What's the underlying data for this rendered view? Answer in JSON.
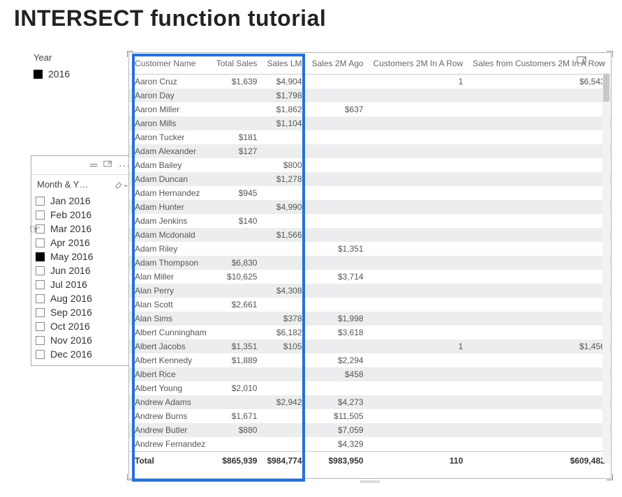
{
  "title": "INTERSECT function tutorial",
  "yearSlicer": {
    "label": "Year",
    "items": [
      {
        "label": "2016",
        "checked": true
      }
    ]
  },
  "monthSlicer": {
    "title": "Month & Y…",
    "items": [
      {
        "label": "Jan 2016",
        "checked": false
      },
      {
        "label": "Feb 2016",
        "checked": false
      },
      {
        "label": "Mar 2016",
        "checked": false
      },
      {
        "label": "Apr 2016",
        "checked": false
      },
      {
        "label": "May 2016",
        "checked": true
      },
      {
        "label": "Jun 2016",
        "checked": false
      },
      {
        "label": "Jul 2016",
        "checked": false
      },
      {
        "label": "Aug 2016",
        "checked": false
      },
      {
        "label": "Sep 2016",
        "checked": false
      },
      {
        "label": "Oct 2016",
        "checked": false
      },
      {
        "label": "Nov 2016",
        "checked": false
      },
      {
        "label": "Dec 2016",
        "checked": false
      }
    ]
  },
  "table": {
    "columns": [
      "Customer Name",
      "Total Sales",
      "Sales LM",
      "Sales 2M Ago",
      "Customers 2M In A Row",
      "Sales from Customers 2M In A Row"
    ],
    "rows": [
      {
        "name": "Aaron Cruz",
        "totalSales": "$1,639",
        "salesLM": "$4,904",
        "sales2M": "",
        "c2m": "1",
        "sf2m": "$6,543"
      },
      {
        "name": "Aaron Day",
        "totalSales": "",
        "salesLM": "$1,798",
        "sales2M": "",
        "c2m": "",
        "sf2m": ""
      },
      {
        "name": "Aaron Miller",
        "totalSales": "",
        "salesLM": "$1,862",
        "sales2M": "$637",
        "c2m": "",
        "sf2m": ""
      },
      {
        "name": "Aaron Mills",
        "totalSales": "",
        "salesLM": "$1,104",
        "sales2M": "",
        "c2m": "",
        "sf2m": ""
      },
      {
        "name": "Aaron Tucker",
        "totalSales": "$181",
        "salesLM": "",
        "sales2M": "",
        "c2m": "",
        "sf2m": ""
      },
      {
        "name": "Adam Alexander",
        "totalSales": "$127",
        "salesLM": "",
        "sales2M": "",
        "c2m": "",
        "sf2m": ""
      },
      {
        "name": "Adam Bailey",
        "totalSales": "",
        "salesLM": "$800",
        "sales2M": "",
        "c2m": "",
        "sf2m": ""
      },
      {
        "name": "Adam Duncan",
        "totalSales": "",
        "salesLM": "$1,278",
        "sales2M": "",
        "c2m": "",
        "sf2m": ""
      },
      {
        "name": "Adam Hernandez",
        "totalSales": "$945",
        "salesLM": "",
        "sales2M": "",
        "c2m": "",
        "sf2m": ""
      },
      {
        "name": "Adam Hunter",
        "totalSales": "",
        "salesLM": "$4,990",
        "sales2M": "",
        "c2m": "",
        "sf2m": ""
      },
      {
        "name": "Adam Jenkins",
        "totalSales": "$140",
        "salesLM": "",
        "sales2M": "",
        "c2m": "",
        "sf2m": ""
      },
      {
        "name": "Adam Mcdonald",
        "totalSales": "",
        "salesLM": "$1,566",
        "sales2M": "",
        "c2m": "",
        "sf2m": ""
      },
      {
        "name": "Adam Riley",
        "totalSales": "",
        "salesLM": "",
        "sales2M": "$1,351",
        "c2m": "",
        "sf2m": ""
      },
      {
        "name": "Adam Thompson",
        "totalSales": "$6,830",
        "salesLM": "",
        "sales2M": "",
        "c2m": "",
        "sf2m": ""
      },
      {
        "name": "Alan Miller",
        "totalSales": "$10,625",
        "salesLM": "",
        "sales2M": "$3,714",
        "c2m": "",
        "sf2m": ""
      },
      {
        "name": "Alan Perry",
        "totalSales": "",
        "salesLM": "$4,308",
        "sales2M": "",
        "c2m": "",
        "sf2m": ""
      },
      {
        "name": "Alan Scott",
        "totalSales": "$2,661",
        "salesLM": "",
        "sales2M": "",
        "c2m": "",
        "sf2m": ""
      },
      {
        "name": "Alan Sims",
        "totalSales": "",
        "salesLM": "$378",
        "sales2M": "$1,998",
        "c2m": "",
        "sf2m": ""
      },
      {
        "name": "Albert Cunningham",
        "totalSales": "",
        "salesLM": "$6,182",
        "sales2M": "$3,618",
        "c2m": "",
        "sf2m": ""
      },
      {
        "name": "Albert Jacobs",
        "totalSales": "$1,351",
        "salesLM": "$105",
        "sales2M": "",
        "c2m": "1",
        "sf2m": "$1,456"
      },
      {
        "name": "Albert Kennedy",
        "totalSales": "$1,889",
        "salesLM": "",
        "sales2M": "$2,294",
        "c2m": "",
        "sf2m": ""
      },
      {
        "name": "Albert Rice",
        "totalSales": "",
        "salesLM": "",
        "sales2M": "$458",
        "c2m": "",
        "sf2m": ""
      },
      {
        "name": "Albert Young",
        "totalSales": "$2,010",
        "salesLM": "",
        "sales2M": "",
        "c2m": "",
        "sf2m": ""
      },
      {
        "name": "Andrew Adams",
        "totalSales": "",
        "salesLM": "$2,942",
        "sales2M": "$4,273",
        "c2m": "",
        "sf2m": ""
      },
      {
        "name": "Andrew Burns",
        "totalSales": "$1,671",
        "salesLM": "",
        "sales2M": "$11,505",
        "c2m": "",
        "sf2m": ""
      },
      {
        "name": "Andrew Butler",
        "totalSales": "$880",
        "salesLM": "",
        "sales2M": "$7,059",
        "c2m": "",
        "sf2m": ""
      },
      {
        "name": "Andrew Fernandez",
        "totalSales": "",
        "salesLM": "",
        "sales2M": "$4,329",
        "c2m": "",
        "sf2m": ""
      }
    ],
    "totals": {
      "label": "Total",
      "totalSales": "$865,939",
      "salesLM": "$984,774",
      "sales2M": "$983,950",
      "c2m": "110",
      "sf2m": "$609,482"
    }
  }
}
